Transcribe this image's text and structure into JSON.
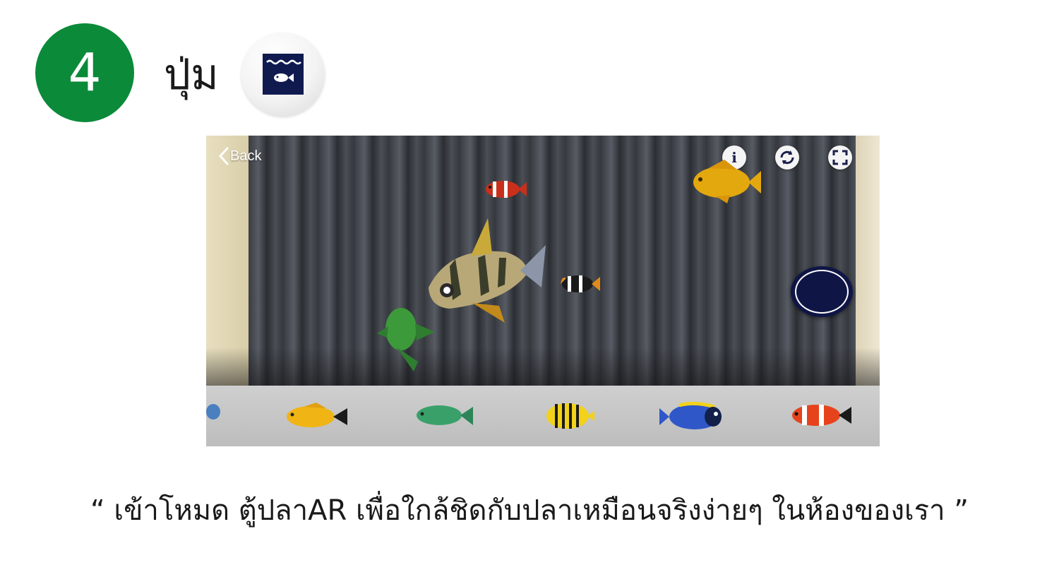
{
  "step": {
    "number": "4",
    "label": "ปุ่ม"
  },
  "mode_button": {
    "icon": "fish-tank-icon",
    "color": "#111a4f"
  },
  "screen": {
    "back_label": "Back",
    "info_icon_glyph": "i",
    "buttons": [
      "info-icon",
      "refresh-icon",
      "fullscreen-icon"
    ],
    "capture_button_color": "#0f1646"
  },
  "scene_fish": [
    "clownfish",
    "goldfish",
    "tiger-barb",
    "clownfish",
    "green-chromis"
  ],
  "tray_fish": [
    "blue-fish",
    "yellow-damselfish",
    "green-chromis",
    "butterflyfish",
    "powder-blue-tang",
    "clownfish"
  ],
  "caption": "“ เข้าโหมด ตู้ปลาAR เพื่อใกล้ชิดกับปลาเหมือนจริงง่ายๆ ในห้องของเรา ”",
  "colors": {
    "step_circle": "#0b8a3a",
    "accent_navy": "#111a4f"
  }
}
